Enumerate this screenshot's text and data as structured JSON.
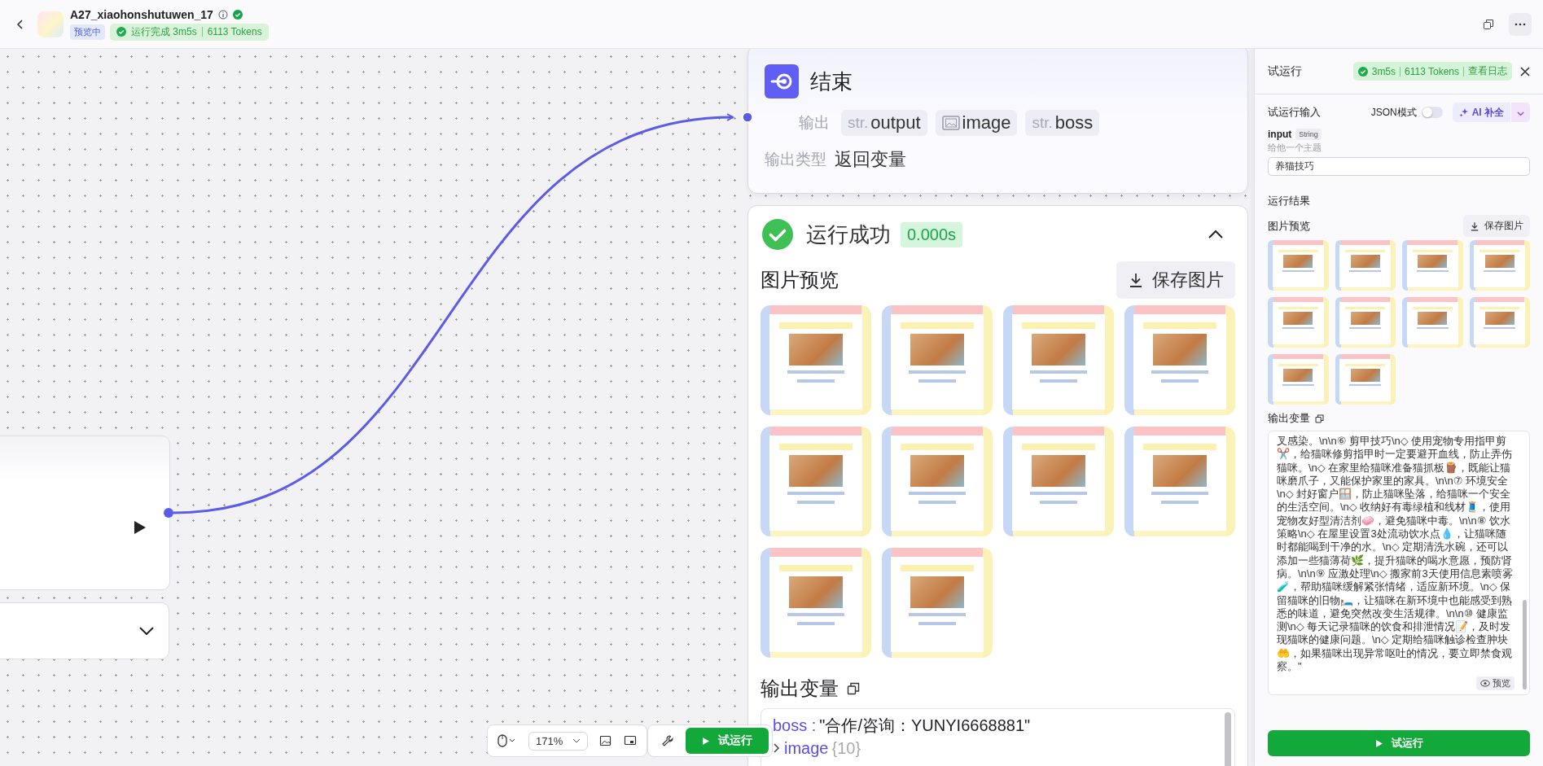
{
  "header": {
    "title": "A27_xiaohonshutuwen_17",
    "badge": "预览中",
    "status": "运行完成 3m5s",
    "tokens": "6113 Tokens"
  },
  "end_node": {
    "title": "结束",
    "output_label": "输出",
    "outputs": [
      {
        "kind": "str",
        "prefix": "str.",
        "name": "output"
      },
      {
        "kind": "image",
        "name": "image"
      },
      {
        "kind": "str",
        "prefix": "str.",
        "name": "boss"
      }
    ],
    "output_type_label": "输出类型",
    "output_type": "返回变量"
  },
  "result": {
    "status": "运行成功",
    "time": "0.000s",
    "expanded": true,
    "preview_title": "图片预览",
    "save_button": "保存图片",
    "images": [
      {
        "kind": "image"
      },
      {
        "kind": "image"
      },
      {
        "kind": "image"
      },
      {
        "kind": "image"
      },
      {
        "kind": "image"
      },
      {
        "kind": "image"
      },
      {
        "kind": "image"
      },
      {
        "kind": "image"
      },
      {
        "kind": "image"
      },
      {
        "kind": "image"
      }
    ],
    "output_title": "输出变量",
    "variables": [
      {
        "kind": "value",
        "key": "boss",
        "separator": ":",
        "value": "\"合作/咨询：YUNYI6668881\""
      },
      {
        "kind": "group",
        "key": "image",
        "count": "{10}",
        "expanded": false
      }
    ]
  },
  "toolbar": {
    "zoom": "171%",
    "run_button": "试运行"
  },
  "panel": {
    "title": "试运行",
    "duration": "3m5s",
    "tokens": "6113 Tokens",
    "log_link": "查看日志",
    "input_title": "试运行输入",
    "json_mode_label": "JSON模式",
    "json_mode": false,
    "ai_button": "AI 补全",
    "field": {
      "name": "input",
      "type": "String",
      "hint": "给他一个主题",
      "value": "养猫技巧"
    },
    "result_title": "运行结果",
    "preview_title": "图片预览",
    "save_button": "保存图片",
    "thumbnails": [
      {
        "kind": "image"
      },
      {
        "kind": "image"
      },
      {
        "kind": "image"
      },
      {
        "kind": "image"
      },
      {
        "kind": "image"
      },
      {
        "kind": "image"
      },
      {
        "kind": "image"
      },
      {
        "kind": "image"
      },
      {
        "kind": "image"
      },
      {
        "kind": "image"
      }
    ],
    "output_title": "输出变量",
    "output_text": "叉感染。\\n\\n⑥ 剪甲技巧\\n◇ 使用宠物专用指甲剪✂️，给猫咪修剪指甲时一定要避开血线，防止弄伤猫咪。\\n◇ 在家里给猫咪准备猫抓板🪵，既能让猫咪磨爪子，又能保护家里的家具。\\n\\n⑦ 环境安全\\n◇ 封好窗户🪟，防止猫咪坠落，给猫咪一个安全的生活空间。\\n◇ 收纳好有毒绿植和线材🧵，使用宠物友好型清洁剂🧼，避免猫咪中毒。\\n\\n⑧ 饮水策略\\n◇ 在屋里设置3处流动饮水点💧，让猫咪随时都能喝到干净的水。\\n◇ 定期清洗水碗，还可以添加一些猫薄荷🌿，提升猫咪的喝水意愿，预防肾病。\\n\\n⑨ 应激处理\\n◇ 搬家前3天使用信息素喷雾🧪，帮助猫咪缓解紧张情绪，适应新环境。\\n◇ 保留猫咪的旧物🛏️，让猫咪在新环境中也能感受到熟悉的味道，避免突然改变生活规律。\\n\\n⑩ 健康监测\\n◇ 每天记录猫咪的饮食和排泄情况📝，及时发现猫咪的健康问题。\\n◇ 定期给猫咪触诊检查肿块🤲，如果猫咪出现异常呕吐的情况，要立即禁食观察。\"",
    "preview_button": "预览",
    "run_button": "试运行"
  }
}
